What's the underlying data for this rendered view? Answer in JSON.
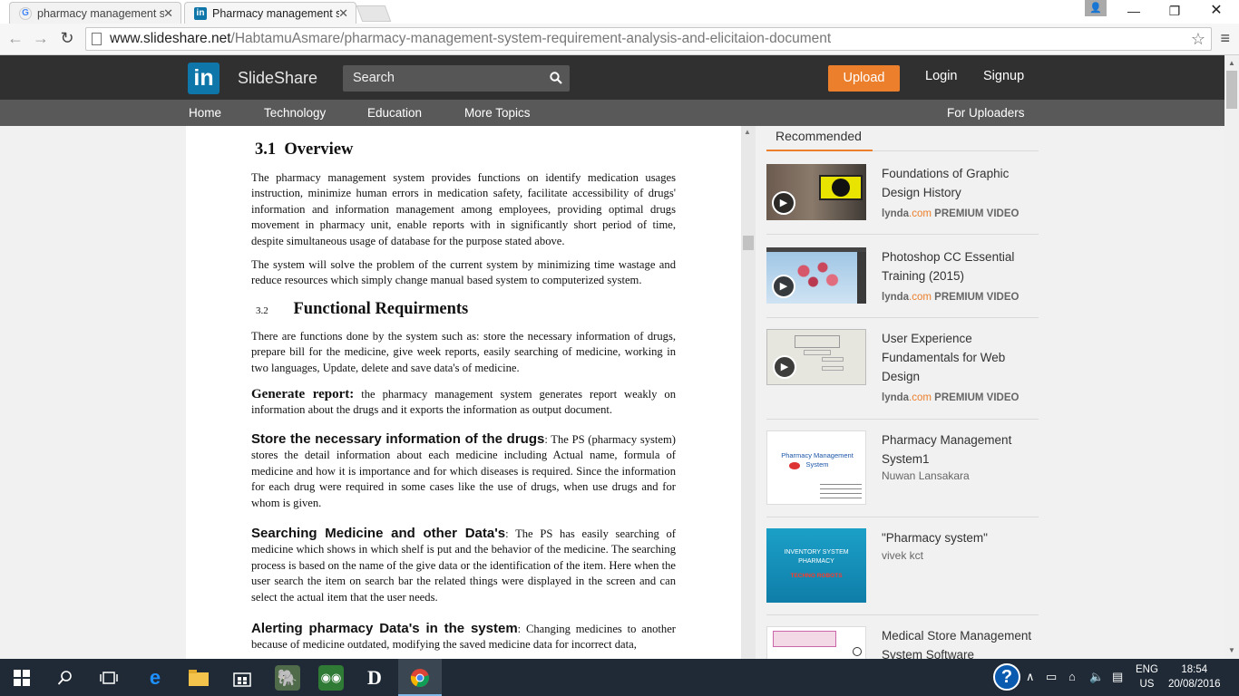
{
  "browser": {
    "tabs": [
      {
        "title": "pharmacy management sy",
        "favicon": "G"
      },
      {
        "title": "Pharmacy management sy",
        "favicon": "in"
      }
    ],
    "url_host": "www.slideshare.net",
    "url_path": "/HabtamuAsmare/pharmacy-management-system-requirement-analysis-and-elicitaion-document"
  },
  "header": {
    "logo": "in",
    "brand": "SlideShare",
    "search_placeholder": "Search",
    "upload_label": "Upload",
    "login_label": "Login",
    "signup_label": "Signup"
  },
  "subnav": {
    "items": [
      "Home",
      "Technology",
      "Education",
      "More Topics"
    ],
    "uploaders": "For Uploaders"
  },
  "document": {
    "h_overview_num": "3.1",
    "h_overview": "Overview",
    "p_overview_1": "The pharmacy management system provides functions on identify medication usages instruction, minimize human errors in medication safety, facilitate accessibility of drugs' information and information management among employees, providing optimal drugs movement in pharmacy unit, enable reports with in significantly short period of time, despite simultaneous usage of database for the purpose stated above.",
    "p_overview_2": "The system will solve the problem of the current system by minimizing time wastage and reduce resources which simply change manual based system to computerized system.",
    "h_func_num": "3.2",
    "h_func": "Functional Requirments",
    "p_func": "There are functions done by the system such as: store the necessary information of drugs, prepare bill for the medicine, give week reports, easily searching of medicine, working in two languages, Update, delete and save data's of medicine.",
    "gen_lead": "Generate report:",
    "gen_text": " the pharmacy management system generates report weakly on information about the drugs and it exports the information as output document.",
    "store_lead": "Store the necessary information of the drugs",
    "store_text": ": The PS (pharmacy system) stores the detail information about each medicine including Actual name, formula of medicine and how it is importance and for which diseases is required. Since the information for each drug were required in some cases like the use of drugs, when use drugs and for whom is given.",
    "search_lead": "Searching Medicine and other Data's",
    "search_text": ": The PS has easily searching of medicine which shows in which shelf is put and the behavior of the medicine. The searching process is based on the name of the give data or the identification of the item. Here when the user search the item on search bar the related things were displayed in the screen and can select the actual item that the user needs.",
    "alert_lead": "Alerting pharmacy Data's in the system",
    "alert_text": ": Changing medicines to another because of medicine outdated, modifying the saved medicine data for incorrect data,"
  },
  "sidebar": {
    "tab_label": "Recommended",
    "cards": [
      {
        "title": "Foundations of Graphic Design History",
        "meta_site": "lynda",
        "meta_dotcom": ".com",
        "meta_badge": "PREMIUM VIDEO"
      },
      {
        "title": "Photoshop CC Essential Training (2015)",
        "meta_site": "lynda",
        "meta_dotcom": ".com",
        "meta_badge": "PREMIUM VIDEO"
      },
      {
        "title": "User Experience Fundamentals for Web Design",
        "meta_site": "lynda",
        "meta_dotcom": ".com",
        "meta_badge": "PREMIUM VIDEO"
      },
      {
        "title": "Pharmacy Management System1",
        "author": "Nuwan Lansakara",
        "thumb_text": "Pharmacy Management System"
      },
      {
        "title": "\"Pharmacy system\"",
        "author": "vivek kct",
        "thumb_text_1": "INVENTORY SYSTEM",
        "thumb_text_2": "PHARMACY",
        "thumb_text_3": "TECHNO ROBOTS"
      },
      {
        "title": "Medical Store Management System Software"
      }
    ]
  },
  "taskbar": {
    "lang_1": "ENG",
    "lang_2": "US",
    "time": "18:54",
    "date": "20/08/2016"
  },
  "colors": {
    "accent": "#ec7f2c",
    "header_bg": "#303030",
    "subnav_bg": "#595959",
    "linkedin": "#0e76a8"
  }
}
